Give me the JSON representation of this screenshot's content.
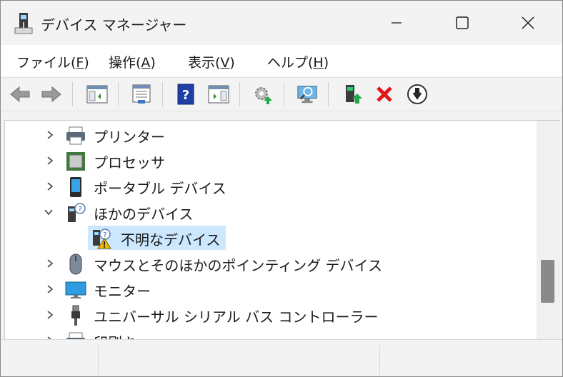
{
  "window": {
    "title": "デバイス マネージャー"
  },
  "menu": [
    {
      "label": "ファイル(",
      "acc": "F",
      "end": ")"
    },
    {
      "label": "操作(",
      "acc": "A",
      "end": ")"
    },
    {
      "label": "表示(",
      "acc": "V",
      "end": ")"
    },
    {
      "label": "ヘルプ(",
      "acc": "H",
      "end": ")"
    }
  ],
  "toolbar": {
    "icons": [
      "back-icon",
      "forward-icon",
      "console-tree-icon",
      "properties-icon",
      "help-icon",
      "show-action-pane-icon",
      "update-driver-icon",
      "scan-hardware-icon",
      "enable-device-icon",
      "uninstall-icon",
      "disable-device-icon"
    ]
  },
  "tree": {
    "items": [
      {
        "label": "プリンター",
        "expanded": false,
        "icon": "printer-icon"
      },
      {
        "label": "プロセッサ",
        "expanded": false,
        "icon": "processor-icon"
      },
      {
        "label": "ポータブル デバイス",
        "expanded": false,
        "icon": "portable-device-icon"
      },
      {
        "label": "ほかのデバイス",
        "expanded": true,
        "icon": "other-devices-icon"
      },
      {
        "label": "不明なデバイス",
        "child": true,
        "selected": true,
        "icon": "unknown-device-warning-icon"
      },
      {
        "label": "マウスとそのほかのポインティング デバイス",
        "expanded": false,
        "icon": "mouse-icon"
      },
      {
        "label": "モニター",
        "expanded": false,
        "icon": "monitor-icon"
      },
      {
        "label": "ユニバーサル シリアル バス コントローラー",
        "expanded": false,
        "icon": "usb-icon"
      },
      {
        "label": "印刷キュー",
        "expanded": false,
        "icon": "print-queue-icon"
      }
    ]
  },
  "colors": {
    "selection": "#cce8ff",
    "accent": "#1f5fbf",
    "warning": "#f2b800",
    "danger": "#e0161b"
  }
}
